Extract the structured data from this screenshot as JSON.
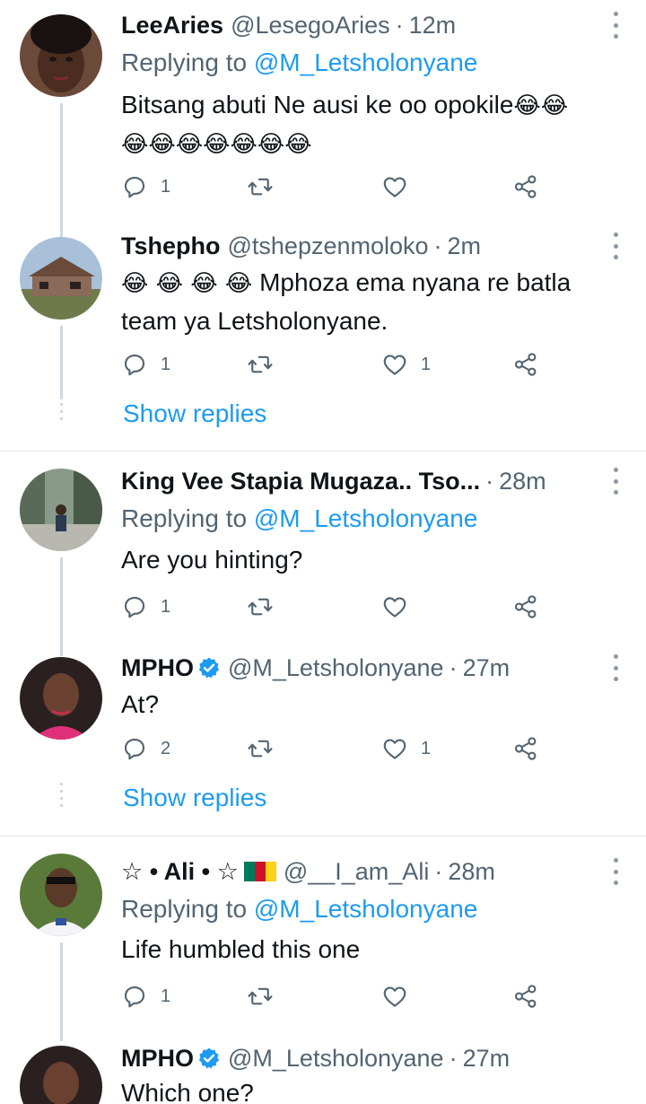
{
  "tweets": [
    {
      "name": "LeeAries",
      "handle": "@LesegoAries",
      "time": "12m",
      "replying_prefix": "Replying to",
      "replying_to": "@M_Letsholonyane",
      "text": "Bitsang abuti Ne ausi ke oo opokile",
      "emoji_line1": "😂😂",
      "emoji_line2": "😂😂😂😂😂😂😂",
      "reply_count": "1",
      "retweet_count": "",
      "like_count": ""
    },
    {
      "name": "Tshepho",
      "handle": "@tshepzenmoloko",
      "time": "2m",
      "emoji_prefix": "😂 😂 😂 😂",
      "text_line1": "Mphoza ema nyana re batla",
      "text_line2": "team ya Letsholonyane.",
      "reply_count": "1",
      "retweet_count": "",
      "like_count": "1",
      "show_replies": "Show replies"
    },
    {
      "name": "King Vee Stapia Mugaza.. Tso...",
      "time": "28m",
      "replying_prefix": "Replying to",
      "replying_to": "@M_Letsholonyane",
      "text": "Are you hinting?",
      "reply_count": "1",
      "retweet_count": "",
      "like_count": ""
    },
    {
      "name": "MPHO",
      "handle": "@M_Letsholonyane",
      "time": "27m",
      "text": "At?",
      "reply_count": "2",
      "retweet_count": "",
      "like_count": "1",
      "show_replies": "Show replies"
    },
    {
      "name_prefix": "☆ • Ali • ☆",
      "handle": "@__I_am_Ali",
      "time": "28m",
      "replying_prefix": "Replying to",
      "replying_to": "@M_Letsholonyane",
      "text": "Life humbled this one",
      "reply_count": "1",
      "retweet_count": "",
      "like_count": ""
    },
    {
      "name": "MPHO",
      "handle": "@M_Letsholonyane",
      "time": "27m",
      "text": "Which one?"
    }
  ],
  "separator": "·",
  "icons": {
    "reply": "reply-icon",
    "retweet": "retweet-icon",
    "like": "heart-icon",
    "share": "share-icon",
    "more": "more-vertical-icon",
    "verified": "verified-badge-icon",
    "flag": "cameroon-flag-icon"
  },
  "colors": {
    "link": "#1d9bf0",
    "secondary_text": "#536471",
    "primary_text": "#0f1419",
    "verified": "#1d9bf0",
    "divider": "#e1e6ea"
  }
}
